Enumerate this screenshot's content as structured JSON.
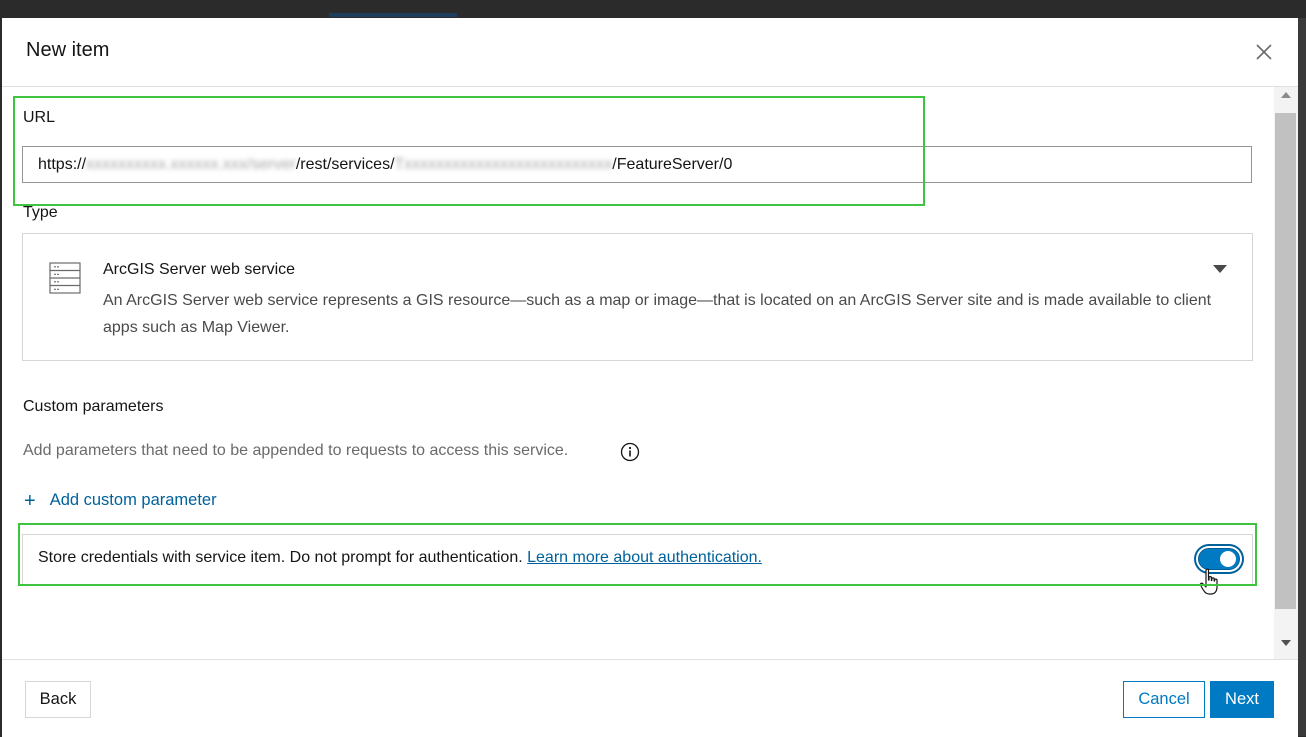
{
  "dialog": {
    "title": "New item",
    "close_icon": "close-icon"
  },
  "url_field": {
    "label": "URL",
    "value_prefix": "https://",
    "value_redacted_1": "xxxxxxxxxx.xxxxxx.xxx/server",
    "value_mid": "/rest/services/",
    "value_redacted_2": "Txxxxxxxxxxxxxxxxxxxxxxxxxx",
    "value_suffix": "/FeatureServer/0"
  },
  "type_field": {
    "label": "Type",
    "icon": "server-table-icon",
    "selected_name": "ArcGIS Server web service",
    "selected_description": "An ArcGIS Server web service represents a GIS resource—such as a map or image—that is located on an ArcGIS Server site and is made available to client apps such as Map Viewer."
  },
  "custom_parameters": {
    "label": "Custom parameters",
    "description": "Add parameters that need to be appended to requests to access this service.",
    "add_label": "Add custom parameter",
    "add_icon": "plus-icon"
  },
  "credentials": {
    "text": "Store credentials with service item. Do not prompt for authentication.",
    "link": "Learn more about authentication.",
    "toggle_on": true
  },
  "footer": {
    "back": "Back",
    "cancel": "Cancel",
    "next": "Next"
  },
  "colors": {
    "accent": "#007ac2",
    "link": "#00619b",
    "highlight": "#3ec43e"
  }
}
